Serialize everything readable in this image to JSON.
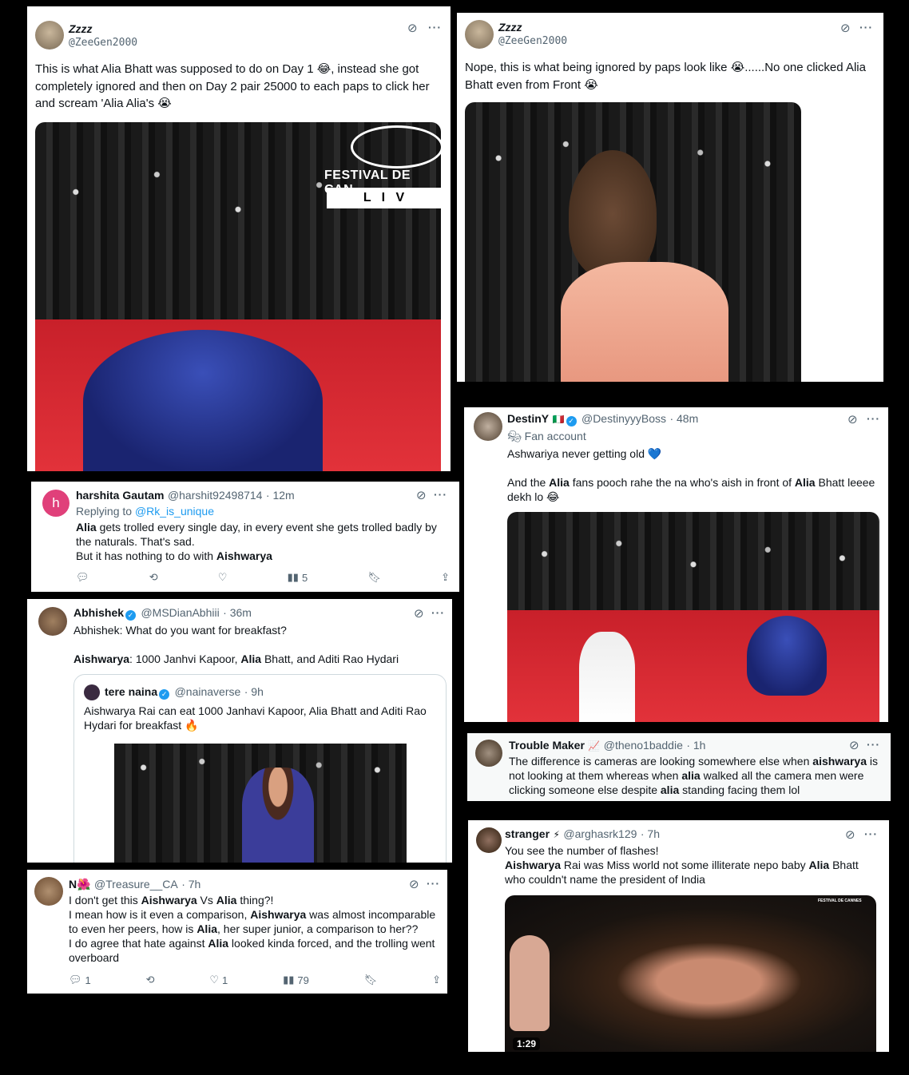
{
  "card1": {
    "name": "Zzzz",
    "handle": "@ZeeGen2000",
    "text": "This is what Alia Bhatt was supposed to do on Day 1 😂, instead she got completely ignored and then on Day 2 pair 25000 to each paps to click her and scream 'Alia Alia's 😭",
    "overlay_festival": "FESTIVAL DE CAN",
    "overlay_live": "L   I   V"
  },
  "card2": {
    "name": "Zzzz",
    "handle": "@ZeeGen2000",
    "text": "Nope, this is what being ignored by paps look like 😭......No one clicked Alia Bhatt even from Front 😭"
  },
  "card3": {
    "name": "harshita Gautam",
    "handle": "@harshit92498714",
    "time": "· 12m",
    "replying_prefix": "Replying to ",
    "replying_to": "@Rk_is_unique",
    "line1_bold": "Alia",
    "line1_rest": " gets trolled every single day, in every event she gets trolled badly by the naturals. That's sad.",
    "line2_pre": "But it has nothing to do with ",
    "line2_bold": "Aishwarya",
    "views": "5"
  },
  "card4": {
    "name": "Abhishek",
    "handle": "@MSDianAbhiii",
    "time": "· 36m",
    "line1": "Abhishek: What do you want for breakfast?",
    "line2_bold1": "Aishwarya",
    "line2_mid": ": 1000 Janhvi Kapoor, ",
    "line2_bold2": "Alia",
    "line2_rest": " Bhatt, and Aditi Rao Hydari",
    "quote": {
      "name": "tere naina",
      "handle": "@nainaverse",
      "time": "· 9h",
      "text": "Aishwarya Rai can eat 1000 Janhavi Kapoor, Alia Bhatt and Aditi Rao Hydari for breakfast 🔥"
    }
  },
  "card5": {
    "name": "N🌺",
    "handle": "@Treasure__CA",
    "time": "· 7h",
    "l1_pre": "I don't get this ",
    "l1_b1": "Aishwarya",
    "l1_mid": " Vs ",
    "l1_b2": "Alia",
    "l1_post": " thing?!",
    "l2_pre": "I mean how is it even a comparison, ",
    "l2_b": "Aishwarya",
    "l2_post": " was almost incomparable to even her peers, how is ",
    "l2_b2": "Alia",
    "l2_post2": ", her super junior, a comparison to her??",
    "l3_pre": "I do agree that hate against ",
    "l3_b": "Alia",
    "l3_post": " looked kinda forced, and the trolling went overboard",
    "replies": "1",
    "likes": "1",
    "views": "79"
  },
  "card6": {
    "name": "DestinY",
    "flag": "🇮🇹",
    "handle": "@DestinyyyBoss",
    "time": "· 48m",
    "badge": "Fan account",
    "line1": "Ashwariya never getting old 💙",
    "l2_pre": "And the ",
    "l2_b1": "Alia",
    "l2_mid": " fans pooch rahe the na who's aish in front of ",
    "l2_b2": "Alia",
    "l2_post": " Bhatt leeee dekh lo 😂"
  },
  "card7": {
    "name": "Trouble Maker",
    "emoji": "📈",
    "handle": "@theno1baddie",
    "time": "· 1h",
    "t1": "The difference is cameras are looking somewhere else when ",
    "b1": "aishwarya",
    "t2": " is not looking at them whereas when ",
    "b2": "alia",
    "t3": " walked all the camera men were clicking someone else despite ",
    "b3": "alia",
    "t4": " standing facing them lol"
  },
  "card8": {
    "name": "stranger",
    "emoji": "⚡",
    "handle": "@arghasrk129",
    "time": "· 7h",
    "line1": "You see the number of flashes!",
    "b1": "Aishwarya",
    "t2": " Rai was Miss world not some illiterate nepo baby ",
    "b2": "Alia",
    "t3": " Bhatt who couldn't name the president of India",
    "duration": "1:29",
    "overlay": "FESTIVAL DE CANNES"
  },
  "colors": {
    "link": "#1d9bf0",
    "muted": "#536471",
    "verified": "#1d9bf0",
    "carpet": "#d42a30"
  }
}
